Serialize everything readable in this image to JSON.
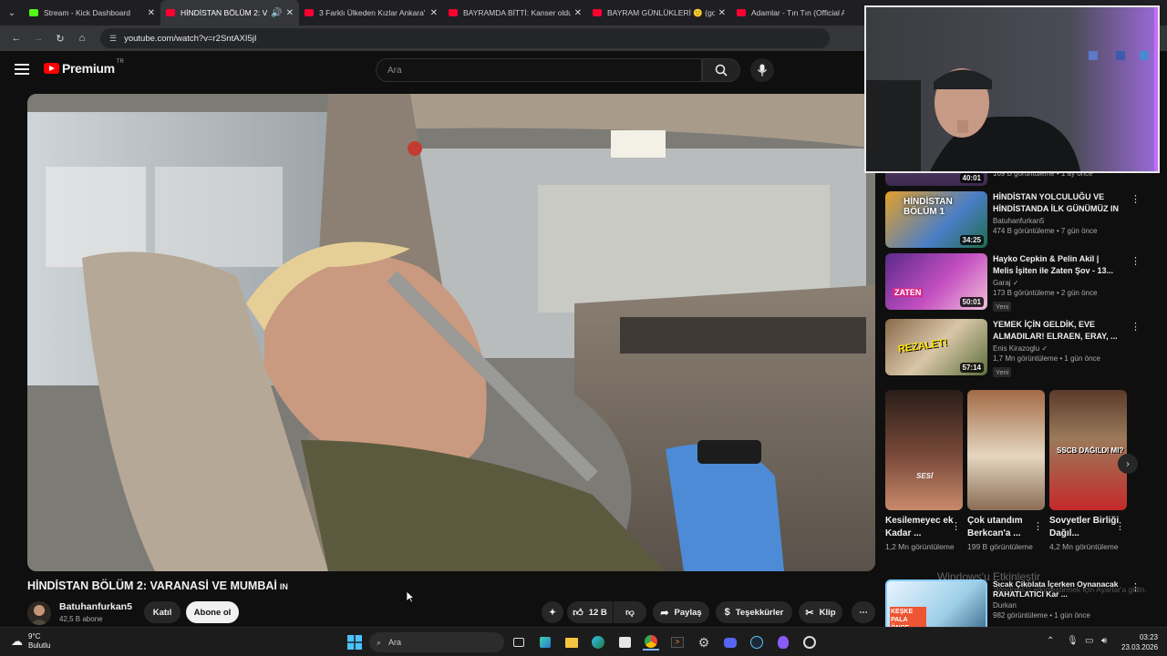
{
  "browser": {
    "tabs": [
      {
        "label": "Stream - Kick Dashboard",
        "fav": "#53fc18"
      },
      {
        "label": "HİNDİSTAN BÖLÜM 2: VARA",
        "fav": "#ff0033",
        "active": true
      },
      {
        "label": "3 Farklı Ülkeden Kızlar Ankara'",
        "fav": "#ff0033"
      },
      {
        "label": "BAYRAMDA BİTTİ: Kanser oldu",
        "fav": "#ff0033"
      },
      {
        "label": "BAYRAM GÜNLÜKLERİ 🙂 (go k",
        "fav": "#ff0033"
      },
      {
        "label": "Adamlar - Tın Tın (Official Au",
        "fav": "#ff0033"
      }
    ],
    "url": "youtube.com/watch?v=r2SntAXI5jI"
  },
  "youtube": {
    "logo_text": "Premium",
    "logo_region": "TR",
    "search_placeholder": "Ara"
  },
  "video": {
    "title": "HİNDİSTAN BÖLÜM 2: VARANASİ VE MUMBAİ",
    "title_suffix": "IN",
    "channel": "Batuhanfurkan5",
    "subscribers": "42,5 B abone",
    "join_label": "Katıl",
    "subscribe_label": "Abone ol",
    "likes": "12 B",
    "share_label": "Paylaş",
    "thanks_label": "Teşekkürler",
    "clip_label": "Klip"
  },
  "related": [
    {
      "title": "HİNDİSTAN YOLCULUĞU VE HİNDİSTANDA İLK GÜNÜMÜZ IN",
      "channel": "Batuhanfurkan5",
      "meta": "474 B görüntüleme • 7 gün önce",
      "duration": "34:25",
      "new": ""
    },
    {
      "title": "Hayko Cepkin & Pelin Akil | Melis İşiten ile Zaten Şov - 13...",
      "channel": "Garaj ✓",
      "meta": "173 B görüntüleme • 2 gün önce",
      "duration": "50:01",
      "new": "Yeni"
    },
    {
      "title": "YEMEK İÇİN GELDİK, EVE ALMADILAR! ELRAEN, ERAY, ...",
      "channel": "Enis Kirazoglu ✓",
      "meta": "1,7 Mn görüntüleme • 1 gün önce",
      "duration": "57:14",
      "new": "Yeni"
    }
  ],
  "partial_top": {
    "meta": "169 B görüntüleme • 1 ay önce",
    "duration": "40:01"
  },
  "shorts": [
    {
      "title": "Kesilemeyec ek Kadar ...",
      "views": "1,2 Mn görüntüleme",
      "overlay": "SESİ"
    },
    {
      "title": "Çok utandım Berkcan'a ...",
      "views": "199 B görüntüleme",
      "overlay": ""
    },
    {
      "title": "Sovyetler Birliği Dağıl...",
      "views": "4,2 Mn görüntüleme",
      "overlay": "SSCB DAĞILDI MI?"
    }
  ],
  "bottom_related": {
    "title": "Sıcak Çikolata İçerken Oynanacak RAHATLATICI Kar ...",
    "channel": "Durkan",
    "meta": "982 görüntüleme • 1 gün önce",
    "thumb_text": "KEŞKE PALA ÖNCE"
  },
  "watermark": {
    "line1": "Windows'u Etkinleştir",
    "line2": "Windows'u etkinleştirmek için Ayarlar'a gidin."
  },
  "taskbar": {
    "temp": "9°C",
    "weather": "Bulutlu",
    "search": "Ara",
    "time": "03:23",
    "date": "23.03.2026"
  }
}
